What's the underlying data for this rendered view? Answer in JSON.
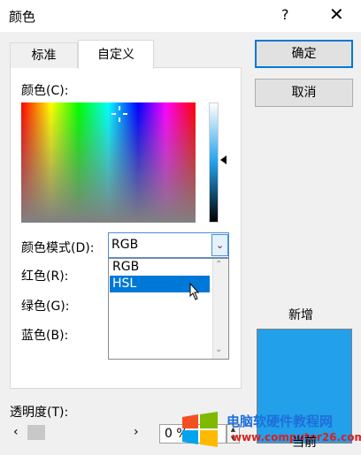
{
  "window": {
    "title": "颜色",
    "help": "?",
    "close": "✕"
  },
  "tabs": [
    {
      "label": "标准"
    },
    {
      "label": "自定义"
    }
  ],
  "custom": {
    "colors_label": "颜色(C):",
    "mode_label": "颜色模式(D):",
    "mode_value": "RGB",
    "mode_options": [
      "RGB",
      "HSL"
    ],
    "highlighted_option": "HSL",
    "red_label": "红色(R):",
    "green_label": "绿色(G):",
    "blue_label": "蓝色(B):"
  },
  "transparency": {
    "label": "透明度(T):",
    "value": "0 %",
    "level": 0
  },
  "buttons": {
    "ok": "确定",
    "cancel": "取消"
  },
  "preview": {
    "new_label": "新增",
    "current_label": "当前",
    "new_color": "#22a0ea"
  },
  "watermark": {
    "line1": "电脑软硬件教程网",
    "line2": "www.computer26.com"
  }
}
